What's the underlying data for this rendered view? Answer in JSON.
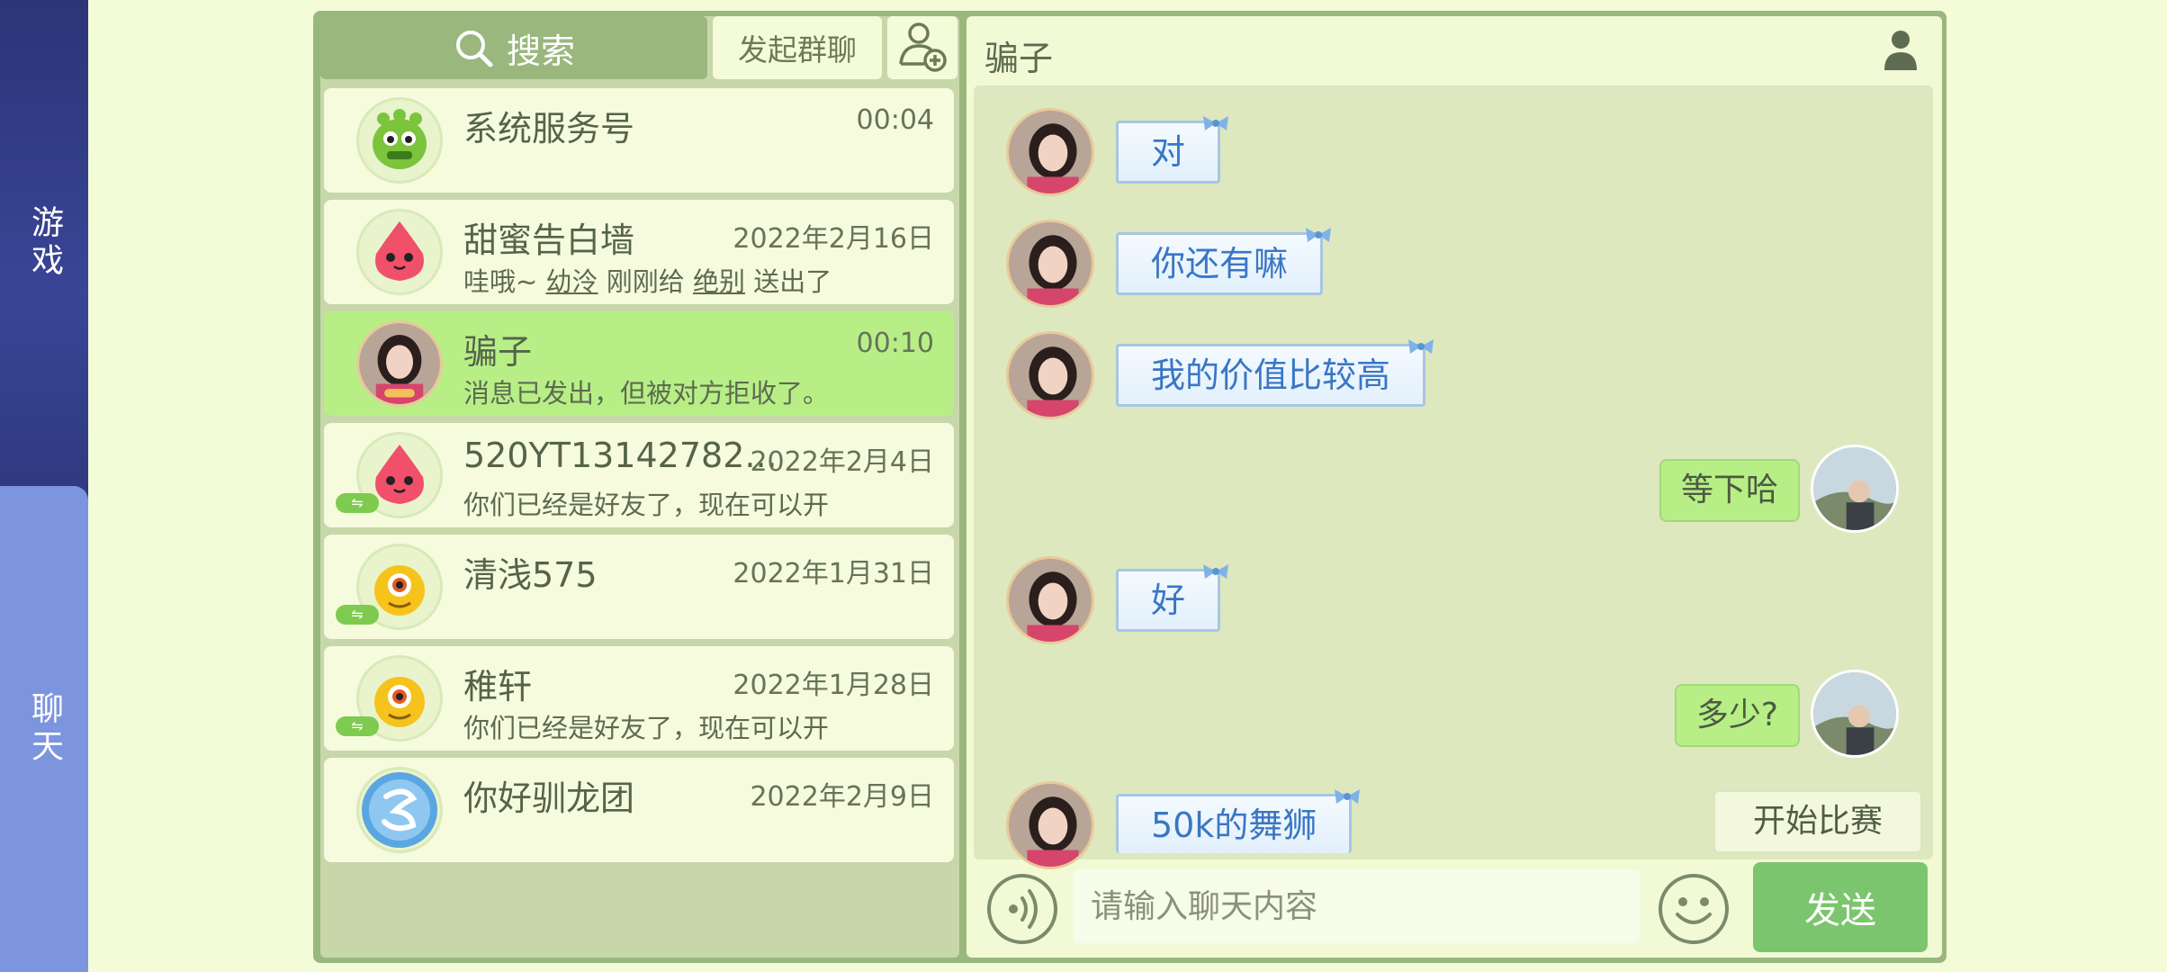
{
  "sidebar": {
    "tabs": [
      {
        "label": "游戏"
      },
      {
        "label": "聊天"
      }
    ]
  },
  "toolbar": {
    "search_label": "搜索",
    "group_chat_label": "发起群聊"
  },
  "contacts": [
    {
      "name": "系统服务号",
      "time": "00:04",
      "preview": ""
    },
    {
      "name": "甜蜜告白墙",
      "time": "2022年2月16日",
      "preview_parts": [
        "哇哦~ ",
        "幼泠",
        " 刚刚给 ",
        "绝别",
        " 送出了"
      ]
    },
    {
      "name": "骗子",
      "time": "00:10",
      "preview": "消息已发出，但被对方拒收了。"
    },
    {
      "name": "520YT13142782...",
      "time": "2022年2月4日",
      "preview": "你们已经是好友了，现在可以开"
    },
    {
      "name": "清浅575",
      "time": "2022年1月31日",
      "preview": ""
    },
    {
      "name": "稚轩",
      "time": "2022年1月28日",
      "preview": "你们已经是好友了，现在可以开"
    },
    {
      "name": "你好驯龙团",
      "time": "2022年2月9日",
      "preview": ""
    }
  ],
  "chat": {
    "title": "骗子",
    "messages": [
      {
        "side": "in",
        "text": "对"
      },
      {
        "side": "in",
        "text": "你还有嘛"
      },
      {
        "side": "in",
        "text": "我的价值比较高"
      },
      {
        "side": "out",
        "text": "等下哈"
      },
      {
        "side": "in",
        "text": "好"
      },
      {
        "side": "out",
        "text": "多少?"
      },
      {
        "side": "in",
        "text": "50k的舞狮"
      }
    ],
    "start_match_label": "开始比赛",
    "input_placeholder": "请输入聊天内容",
    "send_label": "发送"
  },
  "colors": {
    "active_contact": "#b7ef86",
    "incoming_bubble_text": "#3a76c4",
    "send_button": "#7bc56e",
    "sidebar_bg": "#2f3a80",
    "chat_tab_bg": "#7d95de"
  }
}
